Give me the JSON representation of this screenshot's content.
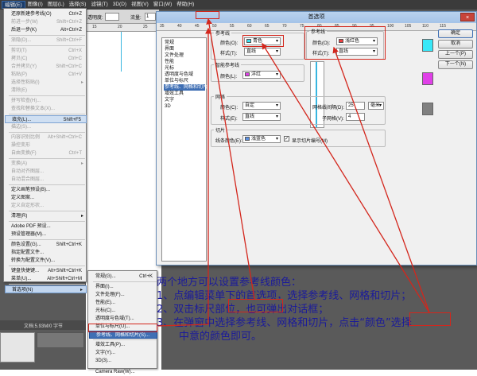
{
  "menubar": {
    "items": [
      "编辑(E)",
      "图像(I)",
      "图层(L)",
      "选择(S)",
      "滤镜(T)",
      "3D(D)",
      "视图(V)",
      "窗口(W)",
      "帮助(H)"
    ],
    "active_index": 0
  },
  "options_bar": {
    "opacity_label": "透明度:",
    "opacity_value": "",
    "flow_label": "流量:",
    "flow_value": "1"
  },
  "app_ruler": {
    "ticks": [
      "15",
      "20",
      "25"
    ]
  },
  "edit_menu": {
    "items": [
      {
        "label": "还原新建参考线(O)",
        "shortcut": "Ctrl+Z",
        "state": "normal"
      },
      {
        "label": "前进一步(W)",
        "shortcut": "Shift+Ctrl+Z",
        "state": "disabled"
      },
      {
        "label": "后退一步(K)",
        "shortcut": "Alt+Ctrl+Z",
        "state": "normal"
      },
      {
        "label": "渐隐(D)...",
        "shortcut": "Shift+Ctrl+F",
        "state": "disabled"
      },
      {
        "label": "剪切(T)",
        "shortcut": "Ctrl+X",
        "state": "disabled"
      },
      {
        "label": "拷贝(C)",
        "shortcut": "Ctrl+C",
        "state": "disabled"
      },
      {
        "label": "合并拷贝(Y)",
        "shortcut": "Shift+Ctrl+C",
        "state": "disabled"
      },
      {
        "label": "粘贴(P)",
        "shortcut": "Ctrl+V",
        "state": "disabled"
      },
      {
        "label": "选择性粘贴(I)",
        "shortcut": "",
        "state": "disabled"
      },
      {
        "label": "清除(E)",
        "shortcut": "",
        "state": "disabled"
      },
      {
        "label": "拼写检查(H)...",
        "shortcut": "",
        "state": "disabled"
      },
      {
        "label": "查找和替换文本(X)...",
        "shortcut": "",
        "state": "disabled"
      },
      {
        "label": "填充(L)...",
        "shortcut": "Shift+F5",
        "state": "highlight"
      },
      {
        "label": "描边(S)...",
        "shortcut": "",
        "state": "disabled"
      },
      {
        "label": "内容识别比例",
        "shortcut": "Alt+Shift+Ctrl+C",
        "state": "disabled"
      },
      {
        "label": "操控变形",
        "shortcut": "",
        "state": "disabled"
      },
      {
        "label": "自由变换(F)",
        "shortcut": "Ctrl+T",
        "state": "disabled"
      },
      {
        "label": "变换(A)",
        "shortcut": "",
        "state": "disabled"
      },
      {
        "label": "自动对齐图层...",
        "shortcut": "",
        "state": "disabled"
      },
      {
        "label": "自动混合图层...",
        "shortcut": "",
        "state": "disabled"
      },
      {
        "label": "定义画笔预设(B)...",
        "shortcut": "",
        "state": "normal"
      },
      {
        "label": "定义图案...",
        "shortcut": "",
        "state": "normal"
      },
      {
        "label": "定义自定形状...",
        "shortcut": "",
        "state": "disabled"
      },
      {
        "label": "清理(R)",
        "shortcut": "",
        "state": "normal"
      },
      {
        "label": "Adobe PDF 预设...",
        "shortcut": "",
        "state": "normal"
      },
      {
        "label": "预设管理器(M)...",
        "shortcut": "",
        "state": "normal"
      },
      {
        "label": "颜色设置(G)...",
        "shortcut": "Shift+Ctrl+K",
        "state": "normal"
      },
      {
        "label": "指定配置文件...",
        "shortcut": "",
        "state": "normal"
      },
      {
        "label": "转换为配置文件(V)...",
        "shortcut": "",
        "state": "normal"
      },
      {
        "label": "键盘快捷键...",
        "shortcut": "Alt+Shift+Ctrl+K",
        "state": "normal"
      },
      {
        "label": "菜单(U)...",
        "shortcut": "Alt+Shift+Ctrl+M",
        "state": "normal"
      },
      {
        "label": "首选项(N)",
        "shortcut": "",
        "state": "highlight2"
      }
    ]
  },
  "prefs_submenu": {
    "items": [
      {
        "label": "常规(G)...",
        "shortcut": "Ctrl+K",
        "selected": false
      },
      {
        "label": "界面(I)...",
        "shortcut": "",
        "selected": false
      },
      {
        "label": "文件处理(F)...",
        "shortcut": "",
        "selected": false
      },
      {
        "label": "性能(E)...",
        "shortcut": "",
        "selected": false
      },
      {
        "label": "光标(C)...",
        "shortcut": "",
        "selected": false
      },
      {
        "label": "透明度与色域(T)...",
        "shortcut": "",
        "selected": false
      },
      {
        "label": "单位与标尺(U)...",
        "shortcut": "",
        "selected": false
      },
      {
        "label": "参考线、网格和切片(S)...",
        "shortcut": "",
        "selected": true
      },
      {
        "label": "增效工具(P)...",
        "shortcut": "",
        "selected": false
      },
      {
        "label": "文字(Y)...",
        "shortcut": "",
        "selected": false
      },
      {
        "label": "3D(3)...",
        "shortcut": "",
        "selected": false
      },
      {
        "label": "Camera Raw(W)...",
        "shortcut": "",
        "selected": false
      }
    ]
  },
  "statusbar": {
    "doc_info": "文档:5.93M/0 字节"
  },
  "dialog": {
    "title": "首选项",
    "close_label": "×",
    "ruler_ticks": [
      "35",
      "40",
      "45",
      "50",
      "55",
      "60",
      "65",
      "70",
      "75",
      "80",
      "85",
      "90",
      "95",
      "100",
      "105",
      "110",
      "115"
    ],
    "categories": [
      "常规",
      "界面",
      "文件处理",
      "性能",
      "光标",
      "透明度与色域",
      "单位与标尺",
      "参考线、网格和切片",
      "增效工具",
      "文字",
      "3D"
    ],
    "selected_category_index": 7,
    "guides": {
      "legend": "参考线",
      "color_label": "颜色(O):",
      "color_value": "青色",
      "color_hex": "#38e0f0",
      "style_label": "样式(T):",
      "style_value": "直线"
    },
    "smart_guides": {
      "legend": "智能参考线",
      "color_label": "颜色(L):",
      "color_value": "洋红",
      "color_hex": "#e040e8"
    },
    "grid": {
      "legend": "网格",
      "color_label": "颜色(C):",
      "color_value": "自定",
      "style_label": "样式(E):",
      "style_value": "直线",
      "gridline_label": "网格线间隔(D):",
      "gridline_value": "25",
      "gridline_unit": "毫米",
      "subdiv_label": "子网格(V):",
      "subdiv_value": "4",
      "color_hex": "#808080"
    },
    "slices": {
      "legend": "切片",
      "line_color_label": "线条颜色(E):",
      "line_color_value": "浅蓝色",
      "line_color_hex": "#5a8fe0",
      "show_numbers_label": "显示切片编号(M)",
      "show_numbers_checked": true
    },
    "zoomed_panel": {
      "legend": "参考线",
      "color_label": "颜色(O):",
      "color_value": "浅红色",
      "color_hex": "#f04040",
      "style_label": "样式(T):",
      "style_value": "直线"
    },
    "buttons": {
      "ok": "确定",
      "cancel": "取消",
      "prev": "上一个(P)",
      "next": "下一个(N)"
    },
    "preview_swatches": [
      "#38e8f8",
      "#e040e8",
      "#808080"
    ]
  },
  "annotation": {
    "line1": "两个地方可以设置参考线颜色：",
    "line2_pre": "1、点编辑菜单下的首选项，选择参考线、网格和切片；",
    "line3_pre": "2、双击",
    "line3_word": "标尺部位",
    "line3_post": "，也可弹出对话框；",
    "line4_pre": "3、在弹窗中选择参考线、网格和切片，点击“",
    "line4_word": "颜色",
    "line4_post": "”选择",
    "line5": "中意的颜色即可。",
    "accent_color": "#d3261c",
    "text_color": "#1b1b9a"
  }
}
